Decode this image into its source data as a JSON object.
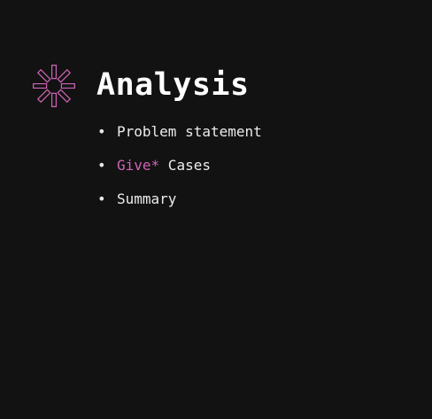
{
  "slide": {
    "title": "Analysis",
    "logo_icon": "asterisk-outline-icon",
    "accent_color": "#d063b6",
    "background_color": "#121212",
    "bullets": [
      {
        "marker": "•",
        "text": "Problem statement"
      },
      {
        "marker": "•",
        "highlight": "Give*",
        "text": " Cases"
      },
      {
        "marker": "•",
        "text": "Summary"
      }
    ]
  }
}
